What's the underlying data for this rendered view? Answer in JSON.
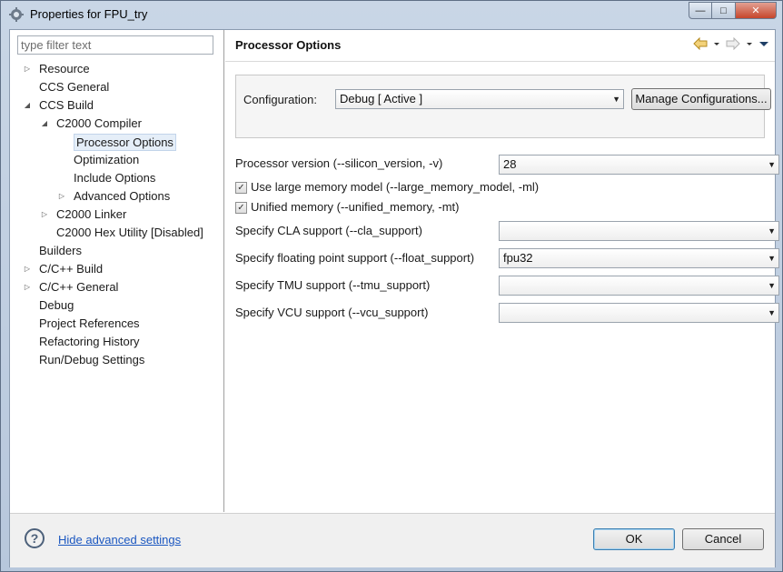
{
  "window": {
    "title": "Properties for FPU_try",
    "minimize": "—",
    "maximize": "□",
    "close": "✕"
  },
  "sidebar": {
    "filter_placeholder": "type filter text",
    "items": [
      {
        "label": "Resource",
        "level": 0,
        "expander": "collapsed"
      },
      {
        "label": "CCS General",
        "level": 0,
        "expander": "none"
      },
      {
        "label": "CCS Build",
        "level": 0,
        "expander": "expanded"
      },
      {
        "label": "C2000 Compiler",
        "level": 1,
        "expander": "expanded"
      },
      {
        "label": "Processor Options",
        "level": 2,
        "expander": "none",
        "selected": true
      },
      {
        "label": "Optimization",
        "level": 2,
        "expander": "none"
      },
      {
        "label": "Include Options",
        "level": 2,
        "expander": "none"
      },
      {
        "label": "Advanced Options",
        "level": 2,
        "expander": "collapsed"
      },
      {
        "label": "C2000 Linker",
        "level": 1,
        "expander": "collapsed"
      },
      {
        "label": "C2000 Hex Utility  [Disabled]",
        "level": 1,
        "expander": "none"
      },
      {
        "label": "Builders",
        "level": 0,
        "expander": "none"
      },
      {
        "label": "C/C++ Build",
        "level": 0,
        "expander": "collapsed"
      },
      {
        "label": "C/C++ General",
        "level": 0,
        "expander": "collapsed"
      },
      {
        "label": "Debug",
        "level": 0,
        "expander": "none"
      },
      {
        "label": "Project References",
        "level": 0,
        "expander": "none"
      },
      {
        "label": "Refactoring History",
        "level": 0,
        "expander": "none"
      },
      {
        "label": "Run/Debug Settings",
        "level": 0,
        "expander": "none"
      }
    ]
  },
  "main": {
    "title": "Processor Options",
    "configuration": {
      "label": "Configuration:",
      "value": "Debug  [ Active ]",
      "manage_button": "Manage Configurations..."
    },
    "processor_version": {
      "label": "Processor version (--silicon_version, -v)",
      "value": "28"
    },
    "large_memory": {
      "label": "Use large memory model (--large_memory_model, -ml)",
      "checked": true
    },
    "unified_memory": {
      "label": "Unified memory (--unified_memory, -mt)",
      "checked": true
    },
    "cla_support": {
      "label": "Specify CLA support (--cla_support)",
      "value": ""
    },
    "float_support": {
      "label": "Specify floating point support (--float_support)",
      "value": "fpu32"
    },
    "tmu_support": {
      "label": "Specify TMU support (--tmu_support)",
      "value": ""
    },
    "vcu_support": {
      "label": "Specify VCU support (--vcu_support)",
      "value": ""
    }
  },
  "footer": {
    "hide_link": "Hide advanced settings",
    "ok": "OK",
    "cancel": "Cancel"
  },
  "colors": {
    "accent": "#3c7fb1",
    "link": "#1b57c0",
    "selection": "#e5eef8"
  }
}
